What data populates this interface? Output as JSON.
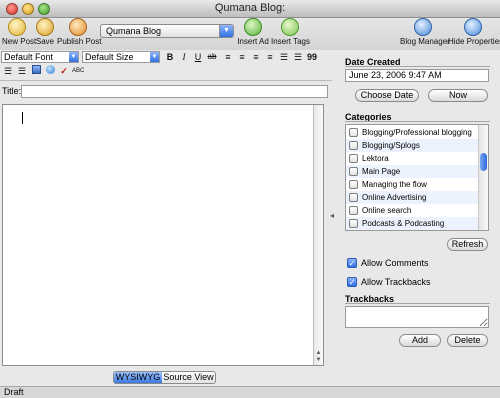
{
  "window": {
    "title": "Qumana Blog:"
  },
  "toolbar": {
    "new_post": "New Post",
    "save": "Save",
    "publish_post": "Publish Post",
    "blog_selected": "Qumana Blog",
    "insert_ad": "Insert Ad",
    "insert_tags": "Insert Tags",
    "blog_manager": "Blog Manager",
    "hide_properties": "Hide Properties"
  },
  "format": {
    "font": "Default Font",
    "size": "Default Size",
    "bold": "B",
    "italic": "I",
    "underline": "U",
    "strike": "ab",
    "quote": "99",
    "spell_check": "ABC"
  },
  "editor": {
    "title_label": "Title:",
    "title_value": ""
  },
  "view": {
    "wysiwyg": "WYSIWYG",
    "source": "Source View"
  },
  "status": {
    "text": "Draft"
  },
  "sidebar": {
    "date_created_label": "Date Created",
    "date_value": "June 23, 2006 9:47 AM",
    "choose_date": "Choose Date",
    "now": "Now",
    "categories_label": "Categories",
    "categories": [
      {
        "label": "Blogging/Professional blogging"
      },
      {
        "label": "Blogging/Splogs"
      },
      {
        "label": "Lektora"
      },
      {
        "label": "Main Page"
      },
      {
        "label": "Managing the flow"
      },
      {
        "label": "Online Advertising"
      },
      {
        "label": "Online search"
      },
      {
        "label": "Podcasts & Podcasting"
      }
    ],
    "refresh": "Refresh",
    "allow_comments": "Allow Comments",
    "allow_trackbacks": "Allow Trackbacks",
    "trackbacks_label": "Trackbacks",
    "add": "Add",
    "delete": "Delete"
  },
  "colors": {
    "accent": "#2f6fe0"
  }
}
